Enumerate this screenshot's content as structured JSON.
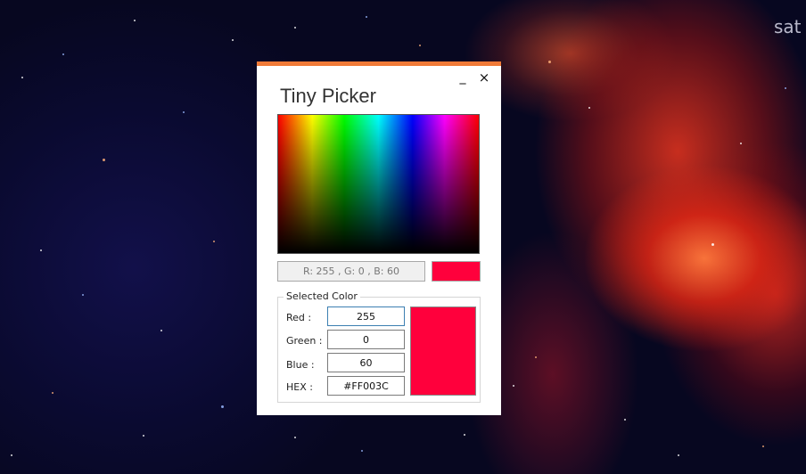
{
  "desktop": {
    "corner_text": "sat"
  },
  "window": {
    "title": "Tiny Picker",
    "accent_color": "#f07a37",
    "minimize_label": "_",
    "close_label": "×"
  },
  "picker": {
    "readout": "R: 255 , G: 0 , B: 60",
    "preview_color": "#FF003C"
  },
  "selected": {
    "group_label": "Selected Color",
    "fields": [
      {
        "label": "Red :",
        "value": "255"
      },
      {
        "label": "Green :",
        "value": "0"
      },
      {
        "label": "Blue :",
        "value": "60"
      },
      {
        "label": "HEX :",
        "value": "#FF003C"
      }
    ],
    "swatch_color": "#FF003C"
  }
}
